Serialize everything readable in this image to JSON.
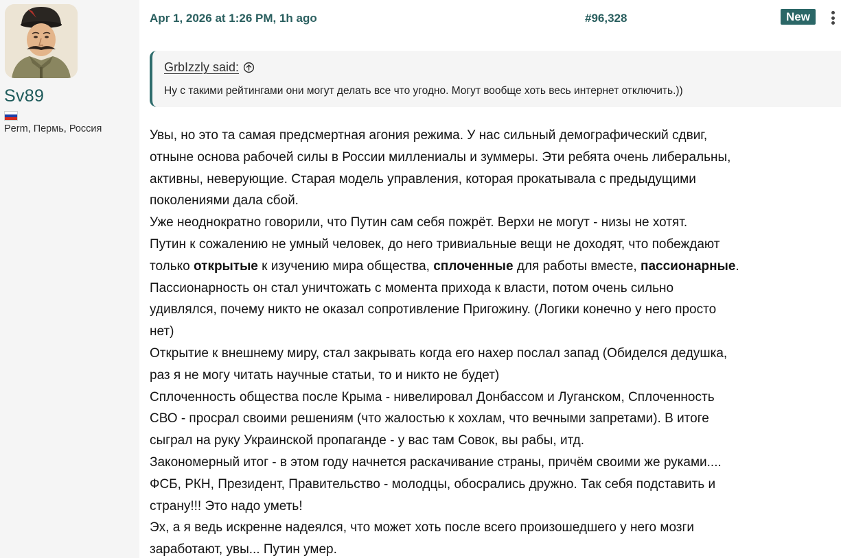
{
  "user": {
    "name": "Sv89",
    "location": "Perm, Пермь, Россия",
    "flag_colors": [
      "#ffffff",
      "#1c3fa8",
      "#d52b1e"
    ],
    "avatar_icon": "cossack-portrait-avatar"
  },
  "meta": {
    "date": "Apr 1, 2026 at 1:26 PM, 1h ago",
    "post_number": "#96,328",
    "badge": "New",
    "more_icon": "vertical-dots-icon"
  },
  "quote": {
    "author": "GrbIzzly said:",
    "icon": "arrow-up-circle-icon",
    "text": "Ну с такими рейтингами они могут делать все что угодно. Могут вообще хоть весь интернет отключить.))"
  },
  "post": {
    "lines": [
      "Увы, но это та самая предсмертная агония режима. У нас сильный демографический сдвиг,",
      "отныне основа рабочей силы в России миллениалы и зуммеры. Эти ребята очень либеральны,",
      "активны, неверующие. Старая модель управления, которая прокатывала с предыдущими",
      "поколениями дала сбой.",
      "Уже неоднократно говорили, что Путин сам себя пожрёт. Верхи не могут - низы не хотят.",
      "Путин к сожалению не умный человек, до него тривиальные вещи не доходят, что побеждают"
    ],
    "bold_line": {
      "p1": "только ",
      "b1": "открытые",
      "p2": " к изучению мира общества, ",
      "b2": "сплоченные",
      "p3": " для работы вместе, ",
      "b3": "пассионарные",
      "p4": "."
    },
    "lines2": [
      "Пассионарность он стал уничтожать с момента прихода к власти, потом очень сильно",
      "удивлялся, почему никто не оказал сопротивление Пригожину. (Логики конечно у него просто",
      "нет)",
      "Открытие к внешнему миру, стал закрывать когда его нахер послал запад (Обиделся дедушка,",
      "раз я не могу читать научные статьи, то и никто не будет)",
      "Сплоченность общества после Крыма - нивелировал Донбассом и Луганском, Сплоченность",
      "СВО - просрал своими решениям (что жалостью к хохлам, что вечными запретами). В итоге",
      "сыграл на руку Украинской пропаганде - у вас там Совок, вы рабы, итд.",
      "Закономерный итог - в этом году начнется раскачивание страны, причём своими же руками....",
      "ФСБ, РКН, Президент, Правительство - молодцы, обосрались дружно. Так себя подставить и",
      "страну!!! Это надо уметь!",
      "Эх, а я ведь искренне надеялся, что может хоть после всего произошедшего у него мозги",
      "заработают, увы... Путин умер."
    ]
  },
  "colors": {
    "accent": "#2b6767",
    "meta_text": "#2a5f5f",
    "username": "#1d5a5a",
    "quote_bg": "#f5f5f5",
    "sidebar_bg": "#f5f5f5"
  }
}
